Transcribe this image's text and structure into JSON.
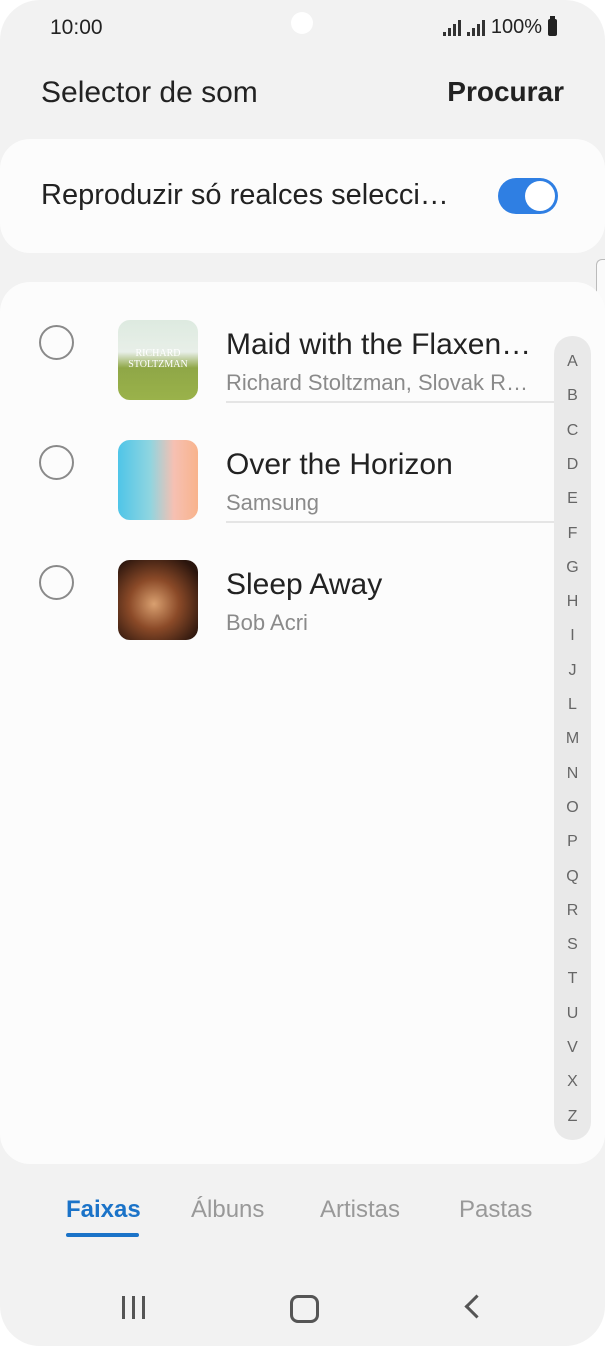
{
  "status_bar": {
    "time": "10:00",
    "battery": "100%"
  },
  "header": {
    "title": "Selector de som",
    "search_label": "Procurar"
  },
  "highlights_toggle": {
    "label": "Reproduzir só realces selecci…",
    "on": true,
    "accent_color": "#2f7fe3"
  },
  "tracks": [
    {
      "title": "Maid with the Flaxen…",
      "subtitle": "Richard Stoltzman, Slovak R…",
      "cover_art_text": "RICHARD STOLTZMAN"
    },
    {
      "title": "Over the Horizon",
      "subtitle": "Samsung"
    },
    {
      "title": "Sleep Away",
      "subtitle": "Bob Acri"
    }
  ],
  "alpha_index": [
    "A",
    "B",
    "C",
    "D",
    "E",
    "F",
    "G",
    "H",
    "I",
    "J",
    "L",
    "M",
    "N",
    "O",
    "P",
    "Q",
    "R",
    "S",
    "T",
    "U",
    "V",
    "X",
    "Z"
  ],
  "tabs": [
    {
      "label": "Faixas",
      "active": true
    },
    {
      "label": "Álbuns",
      "active": false
    },
    {
      "label": "Artistas",
      "active": false
    },
    {
      "label": "Pastas",
      "active": false
    }
  ],
  "colors": {
    "active_tab": "#1b73c8",
    "toggle_on": "#2f7fe3"
  }
}
